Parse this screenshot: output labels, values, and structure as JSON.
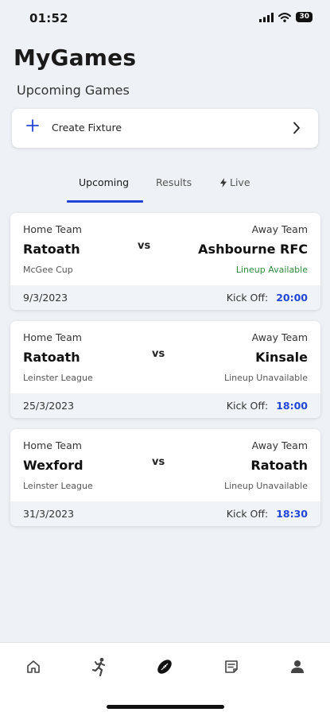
{
  "status_bar": {
    "time": "01:52",
    "battery": "30"
  },
  "app": {
    "title": "MyGames",
    "subtitle": "Upcoming Games"
  },
  "create_fixture": {
    "label": "Create Fixture"
  },
  "tabs": [
    {
      "label": "Upcoming",
      "active": true
    },
    {
      "label": "Results",
      "active": false
    },
    {
      "label": "Live",
      "active": false,
      "icon": "lightning-icon"
    }
  ],
  "games": [
    {
      "home_label": "Home Team",
      "home_team": "Ratoath",
      "competition": "McGee Cup",
      "vs": "vs",
      "away_label": "Away Team",
      "away_team": "Ashbourne RFC",
      "lineup": "Lineup Available",
      "date": "9/3/2023",
      "kickoff_label": "Kick Off:",
      "kickoff_time": "20:00"
    },
    {
      "home_label": "Home Team",
      "home_team": "Ratoath",
      "competition": "Leinster League",
      "vs": "vs",
      "away_label": "Away Team",
      "away_team": "Kinsale",
      "lineup": "Lineup Unavailable",
      "date": "25/3/2023",
      "kickoff_label": "Kick Off:",
      "kickoff_time": "18:00"
    },
    {
      "home_label": "Home Team",
      "home_team": "Wexford",
      "competition": "Leinster League",
      "vs": "vs",
      "away_label": "Away Team",
      "away_team": "Ratoath",
      "lineup": "Lineup Unavailable",
      "date": "31/3/2023",
      "kickoff_label": "Kick Off:",
      "kickoff_time": "18:30"
    }
  ],
  "bottom_nav": {
    "items": [
      "home-icon",
      "player-icon",
      "rugby-ball-icon",
      "notes-icon",
      "profile-icon"
    ]
  },
  "colors": {
    "accent": "#2146d6",
    "available": "#2e8b3e",
    "background": "#eef2f6"
  }
}
